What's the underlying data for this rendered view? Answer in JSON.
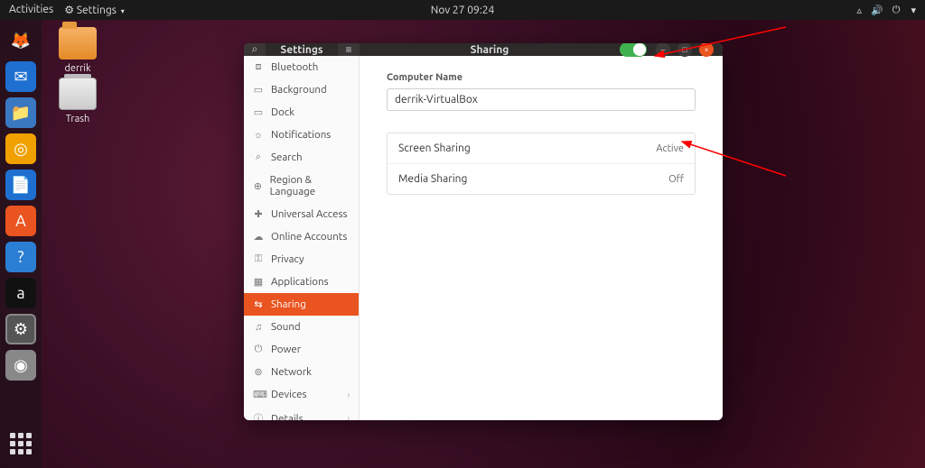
{
  "topbar": {
    "activities": "Activities",
    "appmenu": "Settings",
    "clock": "Nov 27  09:24"
  },
  "desktop": {
    "folder_label": "derrik",
    "trash_label": "Trash"
  },
  "window": {
    "sidebar_title": "Settings",
    "page_title": "Sharing"
  },
  "sidebar": {
    "items": [
      {
        "icon": "⧈",
        "label": "Bluetooth"
      },
      {
        "icon": "▭",
        "label": "Background"
      },
      {
        "icon": "▭",
        "label": "Dock"
      },
      {
        "icon": "☼",
        "label": "Notifications"
      },
      {
        "icon": "⌕",
        "label": "Search"
      },
      {
        "icon": "⊕",
        "label": "Region & Language"
      },
      {
        "icon": "✚",
        "label": "Universal Access"
      },
      {
        "icon": "☁",
        "label": "Online Accounts"
      },
      {
        "icon": "⚿",
        "label": "Privacy"
      },
      {
        "icon": "▦",
        "label": "Applications"
      },
      {
        "icon": "⇆",
        "label": "Sharing",
        "active": true
      },
      {
        "icon": "♫",
        "label": "Sound"
      },
      {
        "icon": "⏻",
        "label": "Power"
      },
      {
        "icon": "⊚",
        "label": "Network"
      },
      {
        "icon": "⌨",
        "label": "Devices",
        "chevron": true
      },
      {
        "icon": "ⓘ",
        "label": "Details",
        "chevron": true
      }
    ]
  },
  "content": {
    "computer_name_label": "Computer Name",
    "computer_name_value": "derrik-VirtualBox",
    "rows": [
      {
        "label": "Screen Sharing",
        "status": "Active"
      },
      {
        "label": "Media Sharing",
        "status": "Off"
      }
    ]
  },
  "dock": {
    "icons": [
      {
        "name": "firefox-icon",
        "glyph": "🦊",
        "bg": "transparent"
      },
      {
        "name": "thunderbird-icon",
        "glyph": "✉",
        "bg": "#1f6fd0"
      },
      {
        "name": "files-icon",
        "glyph": "📁",
        "bg": "#3a78c2"
      },
      {
        "name": "rhythmbox-icon",
        "glyph": "◎",
        "bg": "#f0a000"
      },
      {
        "name": "writer-icon",
        "glyph": "📄",
        "bg": "#1f6fd0"
      },
      {
        "name": "software-icon",
        "glyph": "A",
        "bg": "#e95420"
      },
      {
        "name": "help-icon",
        "glyph": "?",
        "bg": "#2a7fd5"
      },
      {
        "name": "amazon-icon",
        "glyph": "a",
        "bg": "#111"
      },
      {
        "name": "settings-icon",
        "glyph": "⚙",
        "bg": "#555",
        "active": true
      },
      {
        "name": "disc-icon",
        "glyph": "◉",
        "bg": "#888"
      }
    ]
  }
}
